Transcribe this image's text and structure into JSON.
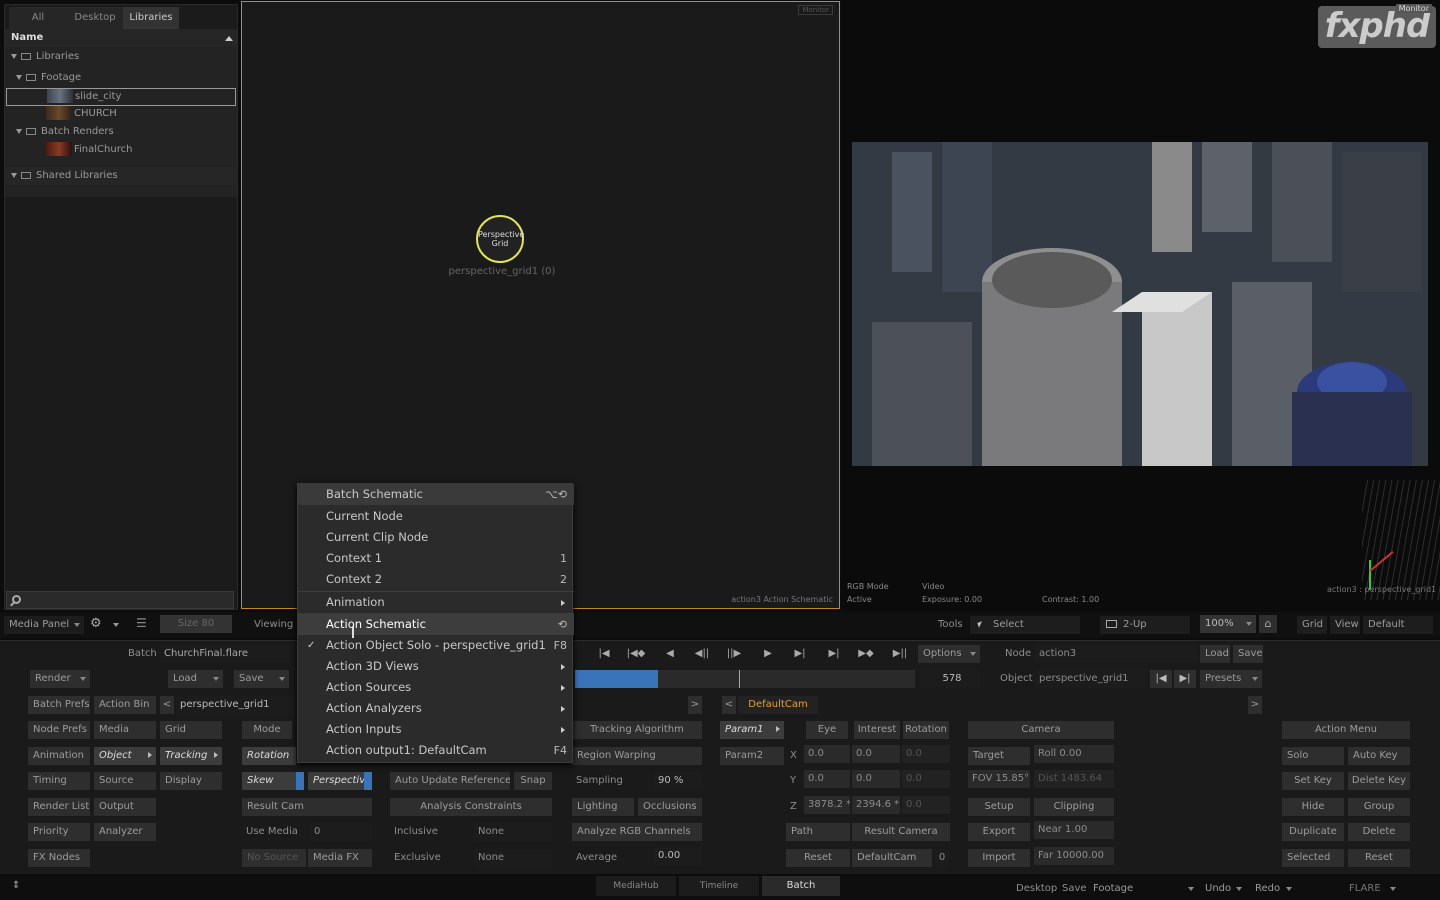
{
  "library": {
    "tabs": [
      "All",
      "Desktop",
      "Libraries"
    ],
    "header": "Name",
    "tree": [
      "Libraries",
      "Footage",
      "slide_city",
      "CHURCH",
      "Batch Renders",
      "FinalChurch",
      "Shared Libraries"
    ]
  },
  "schematic": {
    "monitor_tag": "Monitor",
    "node_line1": "Perspective",
    "node_line2": "Grid",
    "node_caption": "perspective_grid1 (0)",
    "footer": "action3 Action Schematic"
  },
  "viewer": {
    "logo": "fxphd",
    "monitor_tag": "Monitor",
    "rgb_mode": "RGB Mode",
    "active": "Active",
    "video": "Video",
    "exposure": "Exposure: 0.00",
    "contrast": "Contrast: 1.00",
    "corner_text": "action3 : perspective_grid1"
  },
  "menu": {
    "items": [
      {
        "label": "Batch Schematic",
        "shortcut": "⌥⟲"
      },
      {
        "label": "Current Node",
        "shortcut": ""
      },
      {
        "label": "Current Clip Node",
        "shortcut": ""
      },
      {
        "label": "Context 1",
        "shortcut": "1"
      },
      {
        "label": "Context 2",
        "shortcut": "2"
      },
      {
        "label": "Animation",
        "shortcut": ""
      },
      {
        "label": "Action Schematic",
        "shortcut": "⟲"
      },
      {
        "label": "Action Object Solo - perspective_grid1",
        "shortcut": "F8"
      },
      {
        "label": "Action 3D Views",
        "shortcut": ""
      },
      {
        "label": "Action Sources",
        "shortcut": ""
      },
      {
        "label": "Action Analyzers",
        "shortcut": ""
      },
      {
        "label": "Action Inputs",
        "shortcut": ""
      },
      {
        "label": "Action output1: DefaultCam",
        "shortcut": "F4"
      }
    ]
  },
  "toolbar": {
    "media_panel": "Media Panel",
    "size": "Size 80",
    "viewing": "Viewing",
    "tools": "Tools",
    "select": "Select",
    "two_up": "2-Up",
    "zoom": "100%",
    "grid": "Grid",
    "view": "View",
    "default": "Default"
  },
  "batch": {
    "label": "Batch",
    "name": "ChurchFinal.flare",
    "render": "Render",
    "load": "Load",
    "save": "Save",
    "options": "Options",
    "frame": "578",
    "node_label": "Node",
    "node_value": "action3",
    "load2": "Load",
    "save2": "Save",
    "object_label": "Object",
    "object_value": "perspective_grid1",
    "presets": "Presets"
  },
  "left_col": [
    "Batch Prefs",
    "Node Prefs",
    "Animation",
    "Timing",
    "Render List",
    "Priority",
    "FX Nodes"
  ],
  "mid_col": [
    "Action Bin",
    "Media",
    "Object",
    "Source",
    "Output",
    "Analyzer"
  ],
  "col3": [
    "Grid",
    "Tracking",
    "Display"
  ],
  "perspective_name": "perspective_grid1",
  "panel": {
    "mode": "Mode",
    "rotation": "Rotation",
    "skew": "Skew",
    "perspective": "Perspective",
    "result_cam": "Result Cam",
    "use_media": "Use Media",
    "use_media_val": "0",
    "no_source": "No Source",
    "media_fx": "Media FX",
    "auto_update": "Auto Update Reference",
    "snap": "Snap",
    "analysis_constraints": "Analysis Constraints",
    "inclusive": "Inclusive",
    "exclusive": "Exclusive",
    "none1": "None",
    "none2": "None",
    "tracking_algorithm": "Tracking Algorithm",
    "region_warping": "Region Warping",
    "sampling": "Sampling",
    "sampling_val": "90 %",
    "lighting": "Lighting",
    "occlusions": "Occlusions",
    "analyze_rgb": "Analyze RGB Channels",
    "average": "Average",
    "average_val": "0.00"
  },
  "camera_panel": {
    "default_cam": "DefaultCam",
    "param1": "Param1",
    "param2": "Param2",
    "eye": "Eye",
    "interest": "Interest",
    "rotation": "Rotation",
    "x": "X",
    "y": "Y",
    "z": "Z",
    "x_eye": "0.0",
    "x_int": "0.0",
    "x_rot": "0.0",
    "y_eye": "0.0",
    "y_int": "0.0",
    "y_rot": "0.0",
    "z_eye": "3878.2 *",
    "z_int": "2394.6 *",
    "z_rot": "0.0",
    "path": "Path",
    "result_camera": "Result Camera",
    "reset": "Reset",
    "default_cam2": "DefaultCam",
    "default_cam_val": "0",
    "camera": "Camera",
    "target": "Target",
    "roll": "Roll 0.00",
    "fov": "FOV 15.85° *",
    "dist": "Dist 1483.64",
    "setup": "Setup",
    "clipping": "Clipping",
    "export": "Export",
    "near": "Near 1.00",
    "import": "Import",
    "far": "Far 10000.00"
  },
  "action_menu": {
    "title": "Action Menu",
    "solo": "Solo",
    "auto_key": "Auto Key",
    "set_key": "Set Key",
    "delete_key": "Delete Key",
    "hide": "Hide",
    "group": "Group",
    "duplicate": "Duplicate",
    "delete": "Delete",
    "selected": "Selected",
    "reset": "Reset"
  },
  "bottom_tabs": [
    "MediaHub",
    "Timeline",
    "Batch"
  ],
  "status": {
    "desktop": "Desktop",
    "save": "Save",
    "footage": "Footage",
    "undo": "Undo",
    "redo": "Redo",
    "flare": "FLARE"
  },
  "colors": {
    "accent_orange": "#e2a12a",
    "blue_highlight": "#3a74b8",
    "node_ring": "#e3e35a"
  }
}
